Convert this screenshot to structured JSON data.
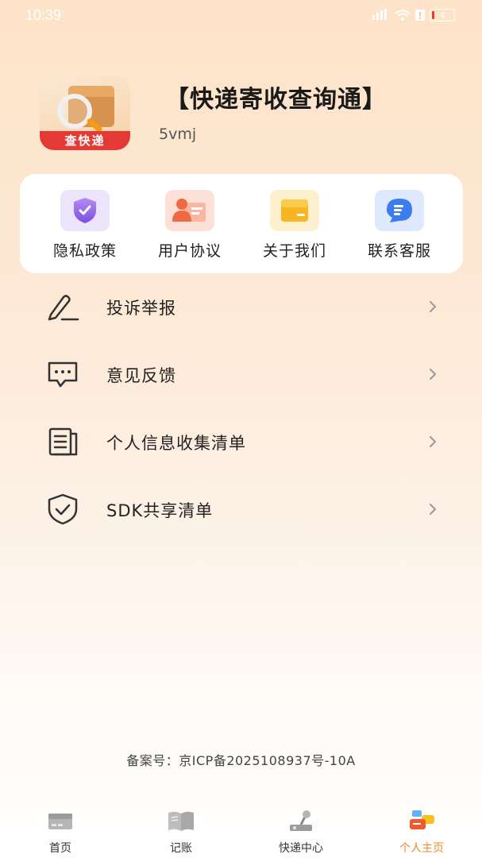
{
  "status_bar": {
    "time": "10:39",
    "battery": "4",
    "signal": "4G"
  },
  "header": {
    "app_icon_text": "查快递",
    "title": "【快递寄收查询通】",
    "subtitle": "5vmj"
  },
  "quick_actions": [
    {
      "label": "隐私政策",
      "icon": "shield-check-icon",
      "color": "#ece4fb"
    },
    {
      "label": "用户协议",
      "icon": "user-card-icon",
      "color": "#fde1d8"
    },
    {
      "label": "关于我们",
      "icon": "folder-icon",
      "color": "#fdf0cf"
    },
    {
      "label": "联系客服",
      "icon": "chat-bubble-icon",
      "color": "#dfe9fd"
    }
  ],
  "menu": [
    {
      "label": "投诉举报",
      "icon": "pencil-icon"
    },
    {
      "label": "意见反馈",
      "icon": "message-dots-icon"
    },
    {
      "label": "个人信息收集清单",
      "icon": "document-list-icon"
    },
    {
      "label": "SDK共享清单",
      "icon": "shield-check-outline-icon"
    }
  ],
  "footer": {
    "icp": "备案号：京ICP备2025108937号-10A"
  },
  "bottom_nav": [
    {
      "label": "首页",
      "icon": "home-box-icon",
      "active": false
    },
    {
      "label": "记账",
      "icon": "book-icon",
      "active": false
    },
    {
      "label": "快递中心",
      "icon": "joystick-icon",
      "active": false
    },
    {
      "label": "个人主页",
      "icon": "profile-chat-icon",
      "active": true
    }
  ],
  "colors": {
    "accent": "#f08a24",
    "background_top": "#fde3c8",
    "banner_red": "#e53935"
  }
}
